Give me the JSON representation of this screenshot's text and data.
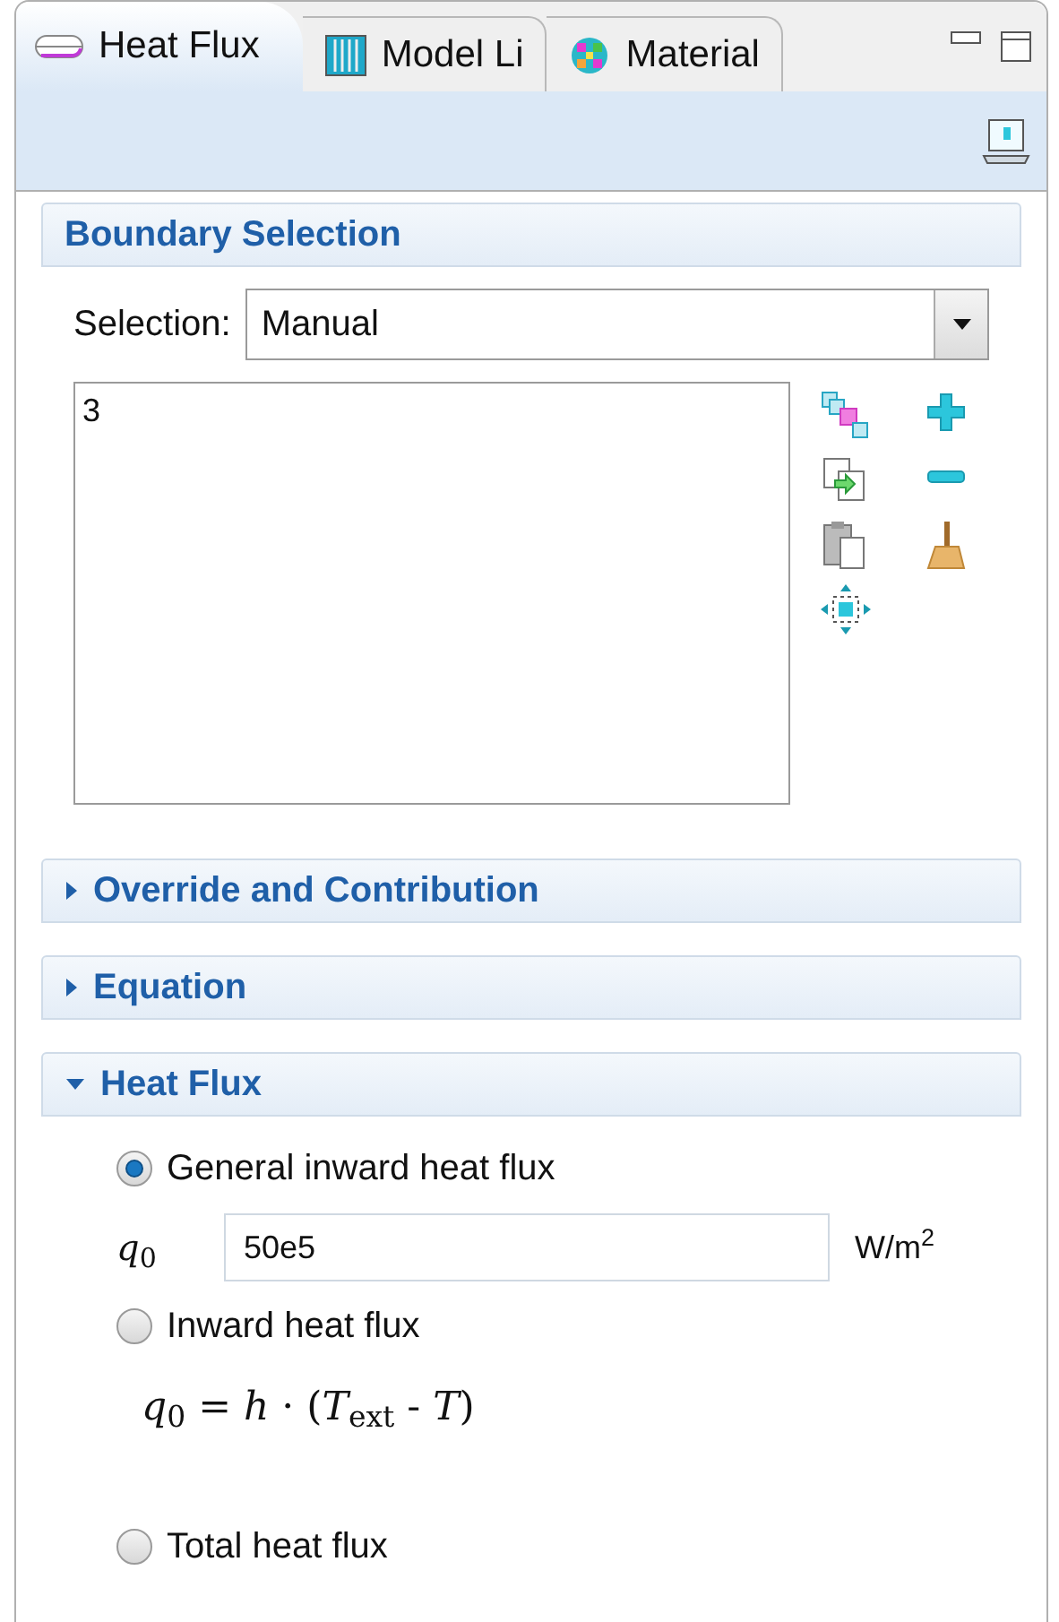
{
  "tabs": [
    {
      "label": "Heat Flux",
      "kind": "heat",
      "selected": true
    },
    {
      "label": "Model Li",
      "kind": "model",
      "selected": false
    },
    {
      "label": "Material",
      "kind": "material",
      "selected": false
    }
  ],
  "sections": [
    {
      "kind": "selection",
      "title": "Boundary Selection",
      "expanded": true,
      "selection_label": "Selection:",
      "selection_value": "Manual",
      "items": [
        "3"
      ]
    },
    {
      "title": "Override and Contribution",
      "expanded": false
    },
    {
      "title": "Equation",
      "expanded": false
    },
    {
      "kind": "heatflux",
      "title": "Heat Flux",
      "expanded": true,
      "options": [
        {
          "label": "General inward heat flux",
          "selected": true,
          "field": {
            "label": "*q*$_{0}$",
            "value": "50e5",
            "unit": "W/m$^{2}$"
          }
        },
        {
          "label": "Inward heat flux",
          "selected": false,
          "formula": "*q*$_{0}$ = *h* · (*T*$_{ext}$ - *T*)"
        },
        {
          "label": "Total heat flux",
          "selected": false
        }
      ]
    }
  ]
}
